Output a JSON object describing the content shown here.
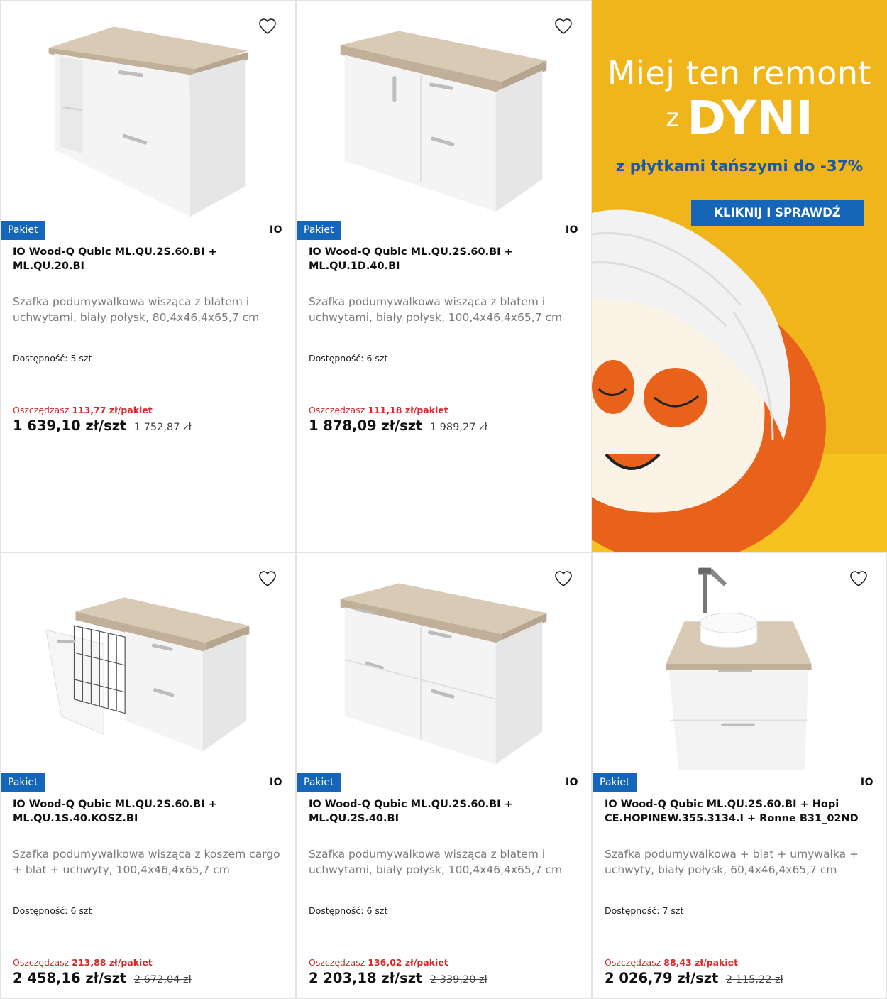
{
  "products": [
    {
      "badge": "Pakiet",
      "brand": "IO",
      "title": "IO Wood-Q Qubic ML.QU.2S.60.BI + ML.QU.20.BI",
      "description": "Szafka podumywalkowa wisząca z blatem i uchwytami, biały połysk, 80,4x46,4x65,7 cm",
      "availability_label": "Dostępność:",
      "availability_value": "5 szt",
      "save_label": "Oszczędzasz",
      "save_value": "113,77 zł/pakiet",
      "price": "1 639,10 zł/szt",
      "old_price": "1 752,87 zł",
      "image_icon": "cabinet-open-shelf-icon"
    },
    {
      "badge": "Pakiet",
      "brand": "IO",
      "title": "IO Wood-Q Qubic ML.QU.2S.60.BI + ML.QU.1D.40.BI",
      "description": "Szafka podumywalkowa wisząca z blatem i uchwytami, biały połysk, 100,4x46,4x65,7 cm",
      "availability_label": "Dostępność:",
      "availability_value": "6 szt",
      "save_label": "Oszczędzasz",
      "save_value": "111,18 zł/pakiet",
      "price": "1 878,09 zł/szt",
      "old_price": "1 989,27 zł",
      "image_icon": "cabinet-door-drawers-icon"
    },
    {
      "badge": "Pakiet",
      "brand": "IO",
      "title": "IO Wood-Q Qubic ML.QU.2S.60.BI + ML.QU.1S.40.KOSZ.BI",
      "description": "Szafka podumywalkowa wisząca z koszem cargo + blat + uchwyty, 100,4x46,4x65,7 cm",
      "availability_label": "Dostępność:",
      "availability_value": "6 szt",
      "save_label": "Oszczędzasz",
      "save_value": "213,88 zł/pakiet",
      "price": "2 458,16 zł/szt",
      "old_price": "2 672,04 zł",
      "image_icon": "cabinet-cargo-basket-icon"
    },
    {
      "badge": "Pakiet",
      "brand": "IO",
      "title": "IO Wood-Q Qubic ML.QU.2S.60.BI + ML.QU.2S.40.BI",
      "description": "Szafka podumywalkowa wisząca z blatem i uchwytami, biały połysk, 100,4x46,4x65,7 cm",
      "availability_label": "Dostępność:",
      "availability_value": "6 szt",
      "save_label": "Oszczędzasz",
      "save_value": "136,02 zł/pakiet",
      "price": "2 203,18 zł/szt",
      "old_price": "2 339,20 zł",
      "image_icon": "cabinet-four-drawers-icon"
    },
    {
      "badge": "Pakiet",
      "brand": "IO",
      "title": "IO Wood-Q Qubic ML.QU.2S.60.BI + Hopi CE.HOPINEW.355.3134.I + Ronne B31_02ND",
      "description": "Szafka podumywalkowa + blat + umywalka + uchwyty, biały połysk, 60,4x46,4x65,7 cm",
      "availability_label": "Dostępność:",
      "availability_value": "7 szt",
      "save_label": "Oszczędzasz",
      "save_value": "88,43 zł/pakiet",
      "price": "2 026,79 zł/szt",
      "old_price": "2 115,22 zł",
      "image_icon": "cabinet-basin-faucet-icon"
    }
  ],
  "banner": {
    "line1": "Miej ten remont",
    "line2_prefix": "z",
    "line2_main": "DYNI",
    "subline": "z płytkami tańszymi do -37%",
    "cta": "KLIKNIJ I SPRAWDŹ",
    "image_icon": "pumpkin-face-mask-icon"
  },
  "colors": {
    "badge_bg": "#1565b8",
    "save_red": "#d42a2a",
    "banner_yellow": "#f1b51c",
    "banner_blue": "#1e57a8",
    "pumpkin": "#e8621c"
  }
}
